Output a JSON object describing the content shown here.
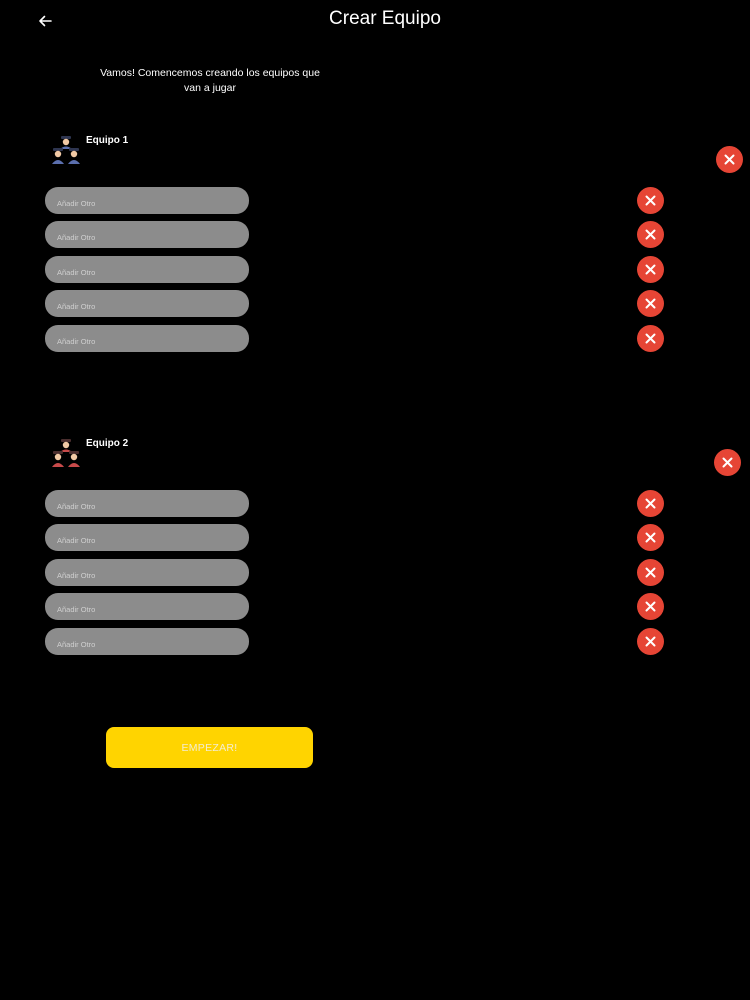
{
  "header": {
    "title": "Crear Equipo",
    "back_icon": "arrow-left-icon"
  },
  "intro": {
    "text": "Vamos! Comencemos creando los equipos que van a jugar"
  },
  "teams": [
    {
      "name": "Equipo 1",
      "icon": "team-people-icon",
      "icon_color": "#5b6fae",
      "players": [
        {
          "value": "",
          "placeholder": "Añadir Otro"
        },
        {
          "value": "",
          "placeholder": "Añadir Otro"
        },
        {
          "value": "",
          "placeholder": "Añadir Otro"
        },
        {
          "value": "",
          "placeholder": "Añadir Otro"
        },
        {
          "value": "",
          "placeholder": "Añadir Otro"
        }
      ]
    },
    {
      "name": "Equipo 2",
      "icon": "team-people-icon",
      "icon_color": "#c84a4a",
      "players": [
        {
          "value": "",
          "placeholder": "Añadir Otro"
        },
        {
          "value": "",
          "placeholder": "Añadir Otro"
        },
        {
          "value": "",
          "placeholder": "Añadir Otro"
        },
        {
          "value": "",
          "placeholder": "Añadir Otro"
        },
        {
          "value": "",
          "placeholder": "Añadir Otro"
        }
      ]
    }
  ],
  "actions": {
    "start_label": "EMPEZAR!"
  },
  "colors": {
    "background": "#000000",
    "input_fill": "#8c8c8c",
    "remove_red": "#e64535",
    "start_yellow": "#ffd400"
  }
}
